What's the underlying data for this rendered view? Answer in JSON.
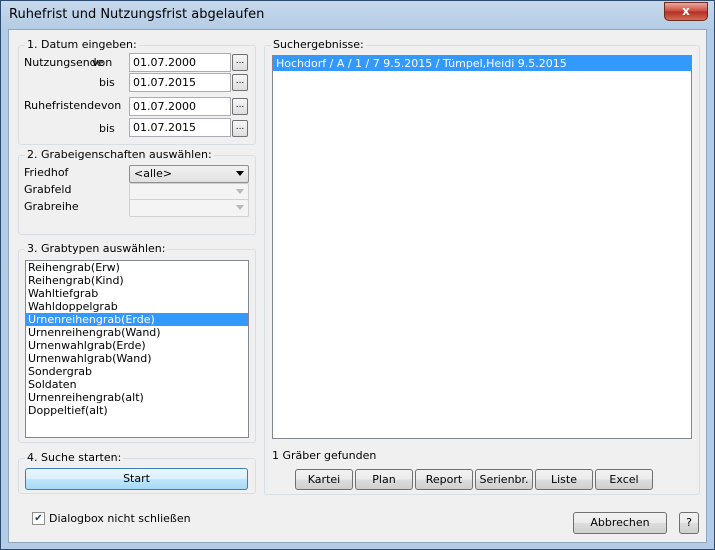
{
  "window": {
    "title": "Ruhefrist und Nutzungsfrist abgelaufen",
    "close_glyph": "x"
  },
  "section1": {
    "label": "1. Datum eingeben:",
    "nutzungsende_label": "Nutzungsende",
    "ruhefristende_label": "Ruhefristende",
    "von_label": "von",
    "bis_label": "bis",
    "nutzung_von": "01.07.2000",
    "nutzung_bis": "01.07.2015",
    "ruhe_von": "01.07.2000",
    "ruhe_bis": "01.07.2015",
    "picker_label": "..."
  },
  "section2": {
    "label": "2. Grabeigenschaften auswählen:",
    "friedhof_label": "Friedhof",
    "friedhof_value": "<alle>",
    "grabfeld_label": "Grabfeld",
    "grabfeld_value": "",
    "grabreihe_label": "Grabreihe",
    "grabreihe_value": ""
  },
  "section3": {
    "label": "3. Grabtypen auswählen:",
    "items": [
      "Reihengrab(Erw)",
      "Reihengrab(Kind)",
      "Wahltiefgrab",
      "Wahldoppelgrab",
      "Urnenreihengrab(Erde)",
      "Urnenreihengrab(Wand)",
      "Urnenwahlgrab(Erde)",
      "Urnenwahlgrab(Wand)",
      "Sondergrab",
      "Soldaten",
      "Urnenreihengrab(alt)",
      "Doppeltief(alt)"
    ],
    "selected_index": 4
  },
  "section4": {
    "label": "4. Suche starten:",
    "start_label": "Start"
  },
  "results": {
    "label": "Suchergebnisse:",
    "items": [
      "Hochdorf / A / 1 / 7  9.5.2015 / Tümpel,Heidi  9.5.2015"
    ],
    "count_text": "1 Gräber gefunden",
    "buttons": {
      "kartei": "Kartei",
      "plan": "Plan",
      "report": "Report",
      "serienbr": "Serienbr.",
      "liste": "Liste",
      "excel": "Excel"
    }
  },
  "footer": {
    "keep_open_label": "Dialogbox nicht schließen",
    "keep_open_checked": true,
    "cancel_label": "Abbrechen",
    "help_label": "?"
  },
  "colors": {
    "selection": "#3399ff",
    "titlebar": "#b3cbe5",
    "close_button": "#c9483a"
  }
}
